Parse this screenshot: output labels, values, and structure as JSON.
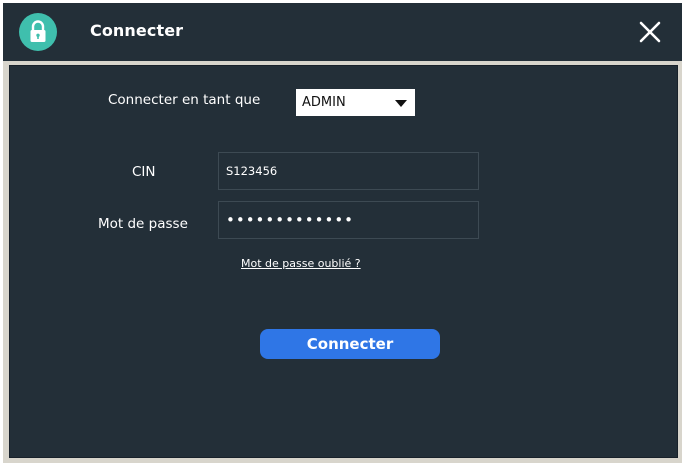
{
  "window": {
    "title": "Connecter",
    "title_icon": "lock-icon",
    "close_icon": "close-icon"
  },
  "form": {
    "role_label": "Connecter en tant que",
    "role_value": "ADMIN",
    "cin_label": "CIN",
    "cin_value": "S123456",
    "password_label": "Mot de passe",
    "password_value": "•••••••••••••",
    "forgot_link": "Mot de passe oublié ?",
    "submit_label": "Connecter"
  },
  "colors": {
    "background": "#232f38",
    "accent_button": "#2f76e6",
    "lock_badge": "#3fbfad",
    "frame": "#d8d5cc"
  }
}
